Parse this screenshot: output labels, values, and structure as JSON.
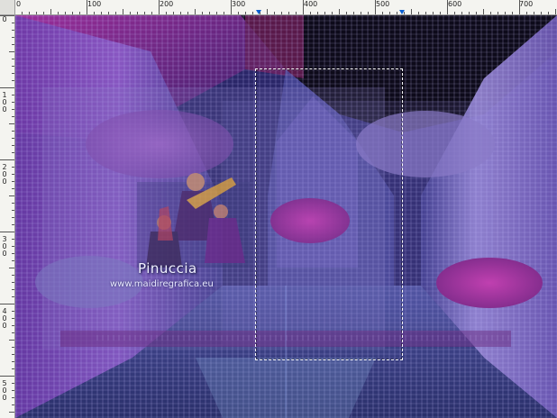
{
  "ruler": {
    "top_labels": [
      "0",
      "100",
      "200",
      "300",
      "400",
      "500",
      "600",
      "700"
    ],
    "left_labels": [
      "0",
      "100",
      "200",
      "300",
      "400",
      "500"
    ]
  },
  "canvas": {
    "watermark_name": "Pinuccia",
    "watermark_url": "www.maidiregrafica.eu"
  },
  "colors": {
    "ruler_bg": "#f4f4f0",
    "app_bg": "#d4d0c8",
    "marker": "#0b5fd1",
    "magenta": "#b03fae",
    "violet": "#5a4fb0"
  }
}
